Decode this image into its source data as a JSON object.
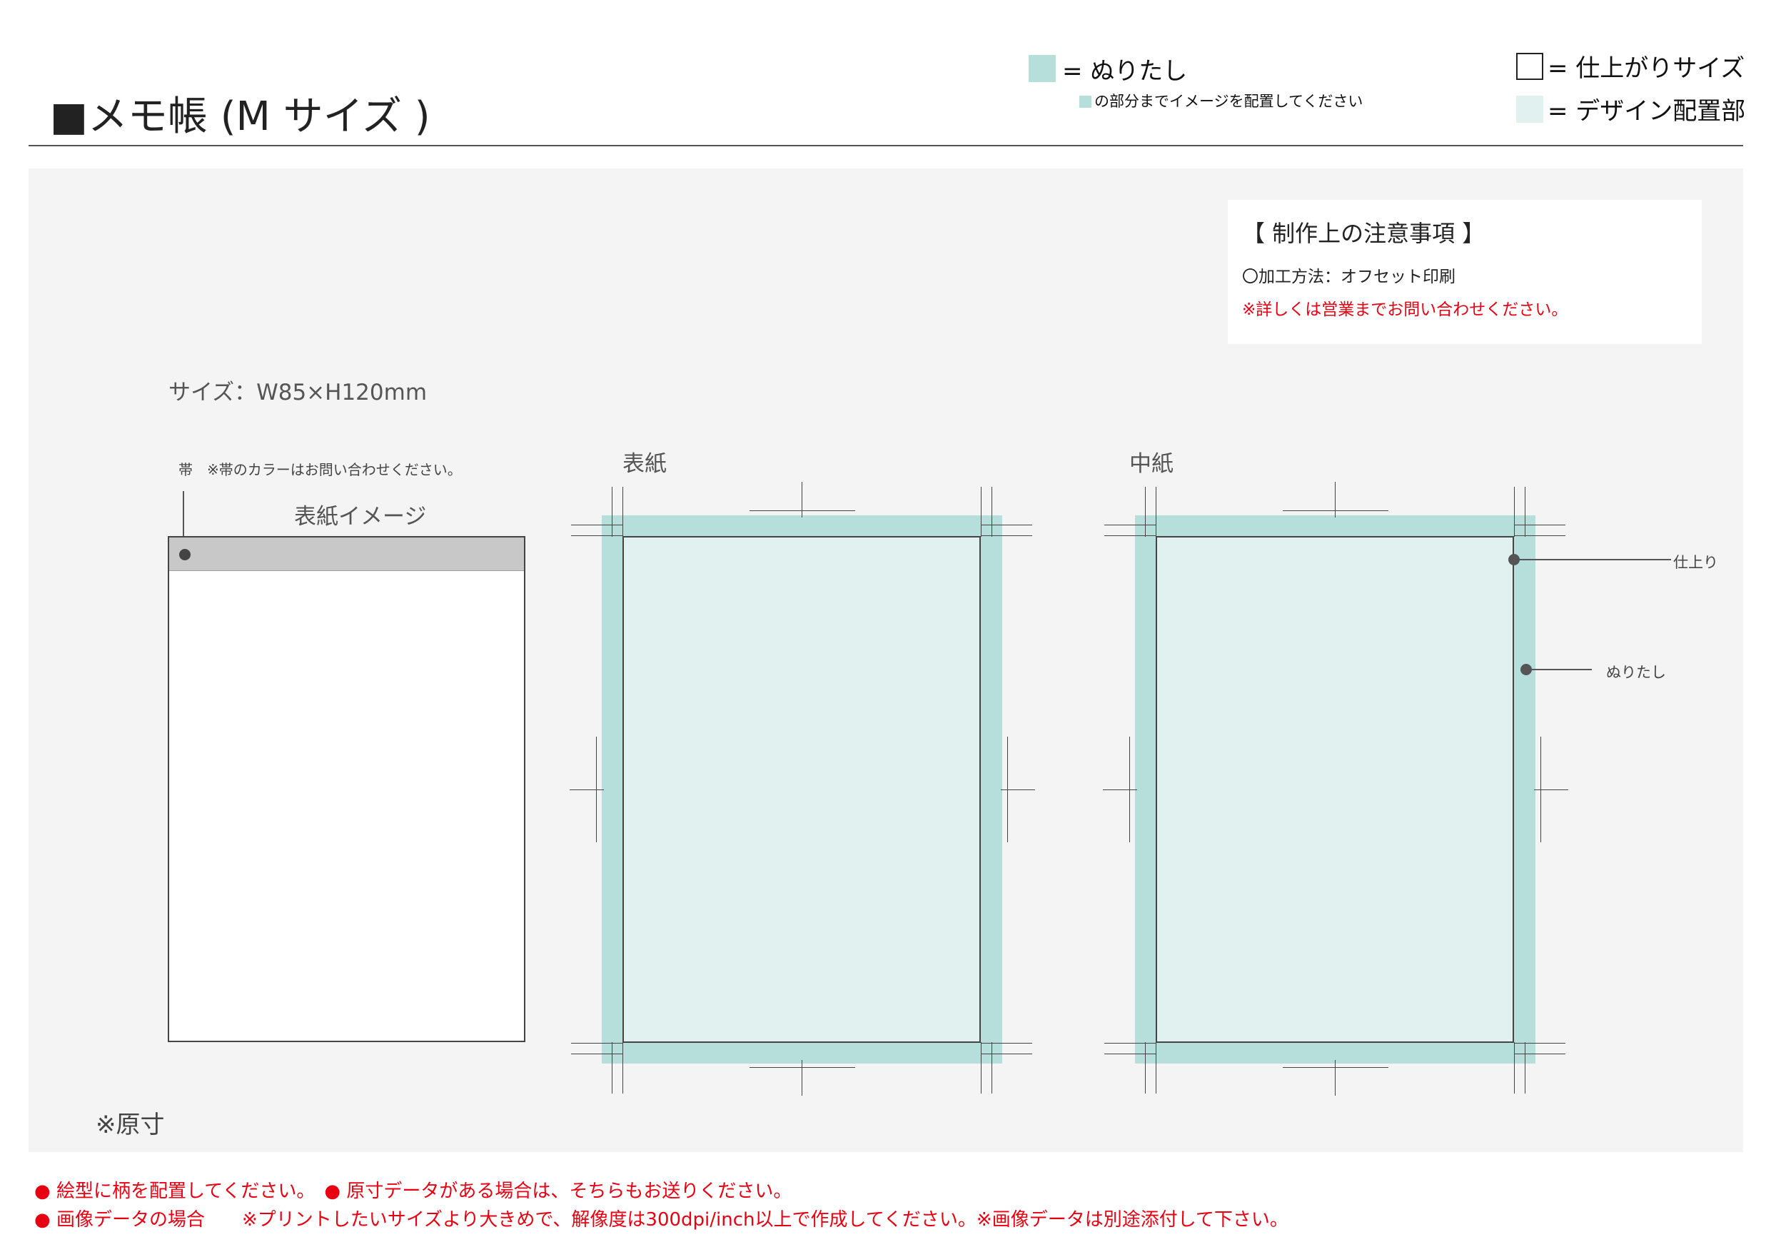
{
  "header": {
    "title": "■メモ帳 (M サイズ )"
  },
  "legend": {
    "bleed_label": "= ぬりたし",
    "bleed_note": "の部分までイメージを配置してください",
    "trim_label": "= 仕上がりサイズ",
    "design_area_label": "= デザイン配置部"
  },
  "notes": {
    "title": "【 制作上の注意事項 】",
    "method": "〇加工方法：オフセット印刷",
    "warning": "※詳しくは営業までお問い合わせください。"
  },
  "diagram": {
    "size_label": "サイズ：W85×H120mm",
    "band_note": "帯　※帯のカラーはお問い合わせください。",
    "cover_image_label": "表紙イメージ",
    "cover_label": "表紙",
    "inner_label": "中紙",
    "trim_callout": "仕上り",
    "bleed_callout": "ぬりたし",
    "original_size_note": "※原寸"
  },
  "footer": {
    "line1": "● 絵型に柄を配置してください。　● 原寸データがある場合は、そちらもお送りください。",
    "line2": "● 画像データの場合　　※プリントしたいサイズより大きめで、解像度は300dpi/inch以上で作成してください。※画像データは別途添付して下さい。"
  },
  "colors": {
    "bleed": "#b6dfdc",
    "design_area": "#e1f1ef",
    "warning_red": "#e60012",
    "panel_bg": "#f4f4f4",
    "band_gray": "#c8c8c8"
  }
}
